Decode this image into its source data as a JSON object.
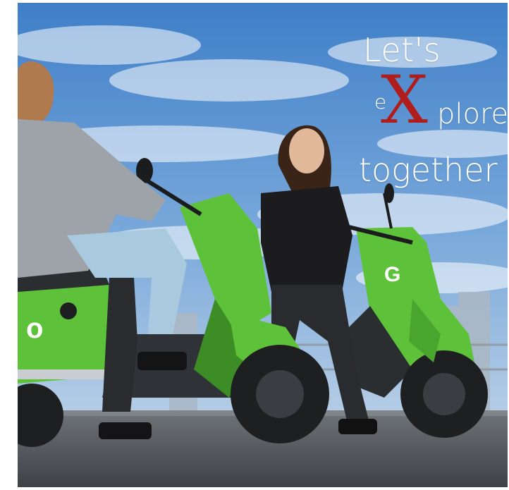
{
  "headline": {
    "line1": "Let's",
    "line2_prefix": "e",
    "line2_accent": "X",
    "line2_suffix": "plore",
    "line3": "together"
  },
  "scooter_badge_left": "o",
  "scooter_badge_right": "G",
  "colors": {
    "sky": "#5a8fd0",
    "scooter_green": "#5dc23a",
    "accent_red": "#b01d1d",
    "asphalt": "#4a4d52"
  }
}
